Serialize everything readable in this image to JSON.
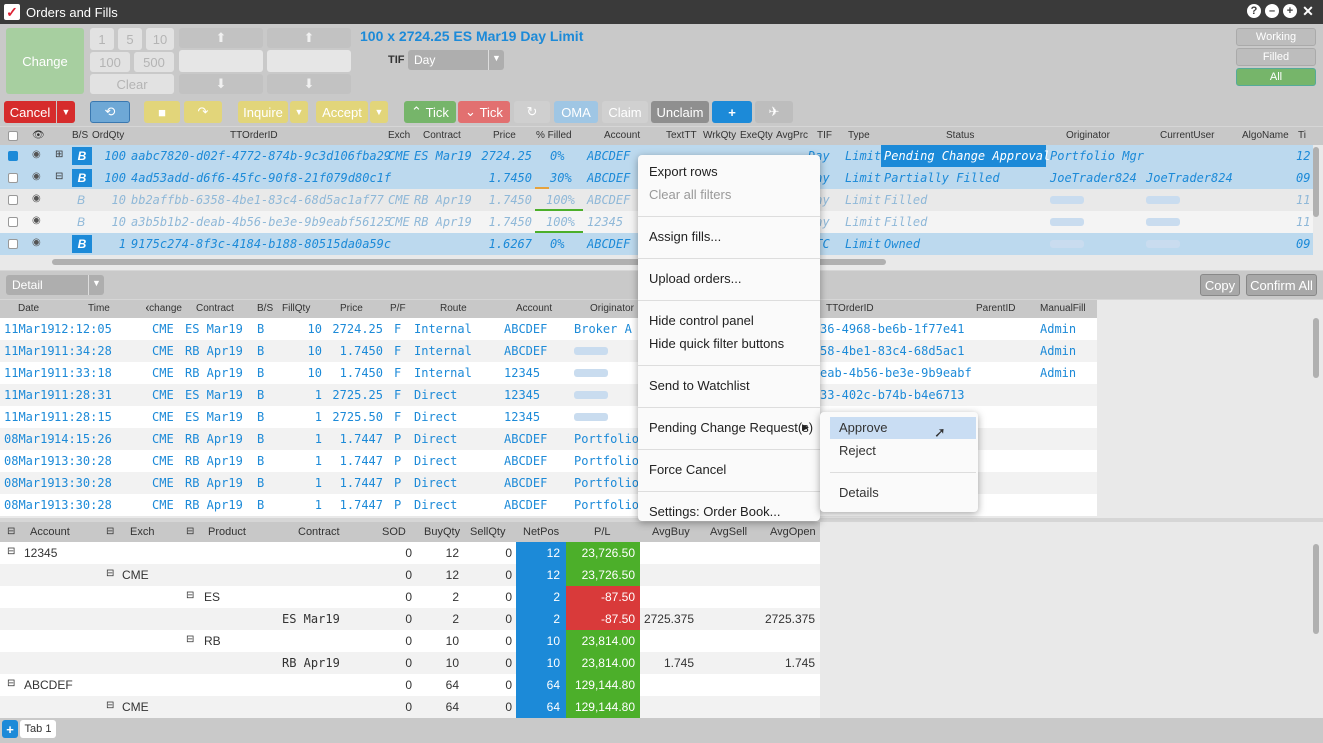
{
  "window": {
    "title": "Orders and Fills"
  },
  "control": {
    "change_label": "Change",
    "qty_buttons": [
      "1",
      "5",
      "10",
      "100",
      "500"
    ],
    "clear_label": "Clear",
    "order_summary": "100 x 2724.25 ES Mar19 Day Limit",
    "tif_label": "TIF",
    "tif_value": "Day",
    "filters": [
      "Working",
      "Filled",
      "All"
    ]
  },
  "toolbar": {
    "cancel": "Cancel",
    "inquire": "Inquire",
    "accept": "Accept",
    "tick_up": "Tick",
    "tick_down": "Tick",
    "oma": "OMA",
    "claim": "Claim",
    "unclaim": "Unclaim"
  },
  "orders": {
    "headers": [
      "B/S",
      "OrdQty",
      "TTOrderID",
      "Exch",
      "Contract",
      "Price",
      "% Filled",
      "Account",
      "TextTT",
      "WrkQty",
      "ExeQty",
      "AvgPrc",
      "TIF",
      "Type",
      "Status",
      "Originator",
      "CurrentUser",
      "AlgoName",
      "Ti"
    ],
    "rows": [
      {
        "bs": "B",
        "qty": "100",
        "id": "aabc7820-d02f-4772-874b-9c3d106fba29",
        "exch": "CME",
        "contract": "ES Mar19",
        "price": "2724.25",
        "filled": "0%",
        "account": "ABCDEF",
        "tif": "Day",
        "type": "Limit",
        "status": "Pending Change Approval",
        "originator": "Portfolio Mgr",
        "user": "",
        "ti": "12"
      },
      {
        "bs": "B",
        "qty": "100",
        "id": "4ad53add-d6f6-45fc-90f8-21f079d80c1f",
        "exch": "",
        "contract": "",
        "price": "1.7450",
        "filled": "30%",
        "account": "ABCDEF",
        "tif": "Day",
        "type": "Limit",
        "status": "Partially Filled",
        "originator": "JoeTrader824",
        "user": "JoeTrader824",
        "ti": "09"
      },
      {
        "bs": "B",
        "qty": "10",
        "id": "bb2affbb-6358-4be1-83c4-68d5ac1af77",
        "exch": "CME",
        "contract": "RB Apr19",
        "price": "1.7450",
        "filled": "100%",
        "account": "ABCDEF",
        "tif": "Day",
        "type": "Limit",
        "status": "Filled",
        "originator": "",
        "user": "",
        "ti": "11"
      },
      {
        "bs": "B",
        "qty": "10",
        "id": "a3b5b1b2-deab-4b56-be3e-9b9eabf56125",
        "exch": "CME",
        "contract": "RB Apr19",
        "price": "1.7450",
        "filled": "100%",
        "account": "12345",
        "tif": "Day",
        "type": "Limit",
        "status": "Filled",
        "originator": "",
        "user": "",
        "ti": "11"
      },
      {
        "bs": "B",
        "qty": "1",
        "id": "9175c274-8f3c-4184-b188-80515da0a59c",
        "exch": "",
        "contract": "",
        "price": "1.6267",
        "filled": "0%",
        "account": "ABCDEF",
        "tif": "GTC",
        "type": "Limit",
        "status": "Owned",
        "originator": "",
        "user": "",
        "ti": "09"
      }
    ]
  },
  "detail": {
    "view": "Detail",
    "copy": "Copy",
    "confirm_all": "Confirm All",
    "headers": [
      "Date",
      "Time",
      "Exchange",
      "Contract",
      "B/S",
      "FillQty",
      "Price",
      "P/F",
      "Route",
      "Account",
      "Originator",
      "TTOrderID",
      "ParentID",
      "ManualFill"
    ],
    "rows": [
      {
        "date": "11Mar19",
        "time": "12:12:05",
        "exch": "CME",
        "contract": "ES Mar19",
        "bs": "B",
        "qty": "10",
        "price": "2724.25",
        "pf": "F",
        "route": "Internal",
        "account": "ABCDEF",
        "orig": "Broker A",
        "ttid": "36-4968-be6b-1f77e41",
        "manual": "Admin"
      },
      {
        "date": "11Mar19",
        "time": "11:34:28",
        "exch": "CME",
        "contract": "RB Apr19",
        "bs": "B",
        "qty": "10",
        "price": "1.7450",
        "pf": "F",
        "route": "Internal",
        "account": "ABCDEF",
        "orig": "",
        "ttid": "58-4be1-83c4-68d5ac1",
        "manual": "Admin"
      },
      {
        "date": "11Mar19",
        "time": "11:33:18",
        "exch": "CME",
        "contract": "RB Apr19",
        "bs": "B",
        "qty": "10",
        "price": "1.7450",
        "pf": "F",
        "route": "Internal",
        "account": "12345",
        "orig": "",
        "ttid": "eab-4b56-be3e-9b9eabf",
        "manual": "Admin"
      },
      {
        "date": "11Mar19",
        "time": "11:28:31",
        "exch": "CME",
        "contract": "ES Mar19",
        "bs": "B",
        "qty": "1",
        "price": "2725.25",
        "pf": "F",
        "route": "Direct",
        "account": "12345",
        "orig": "",
        "ttid": "33-402c-b74b-b4e6713",
        "manual": ""
      },
      {
        "date": "11Mar19",
        "time": "11:28:15",
        "exch": "CME",
        "contract": "ES Mar19",
        "bs": "B",
        "qty": "1",
        "price": "2725.50",
        "pf": "F",
        "route": "Direct",
        "account": "12345",
        "orig": "",
        "ttid": "",
        "manual": ""
      },
      {
        "date": "08Mar19",
        "time": "14:15:26",
        "exch": "CME",
        "contract": "RB Apr19",
        "bs": "B",
        "qty": "1",
        "price": "1.7447",
        "pf": "P",
        "route": "Direct",
        "account": "ABCDEF",
        "orig": "Portfolio",
        "ttid": "",
        "manual": ""
      },
      {
        "date": "08Mar19",
        "time": "13:30:28",
        "exch": "CME",
        "contract": "RB Apr19",
        "bs": "B",
        "qty": "1",
        "price": "1.7447",
        "pf": "P",
        "route": "Direct",
        "account": "ABCDEF",
        "orig": "Portfolio",
        "ttid": "",
        "manual": ""
      },
      {
        "date": "08Mar19",
        "time": "13:30:28",
        "exch": "CME",
        "contract": "RB Apr19",
        "bs": "B",
        "qty": "1",
        "price": "1.7447",
        "pf": "P",
        "route": "Direct",
        "account": "ABCDEF",
        "orig": "Portfolio",
        "ttid": "",
        "manual": ""
      },
      {
        "date": "08Mar19",
        "time": "13:30:28",
        "exch": "CME",
        "contract": "RB Apr19",
        "bs": "B",
        "qty": "1",
        "price": "1.7447",
        "pf": "P",
        "route": "Direct",
        "account": "ABCDEF",
        "orig": "Portfolio",
        "ttid": "",
        "manual": ""
      }
    ]
  },
  "positions": {
    "headers": [
      "Account",
      "Exch",
      "Product",
      "Contract",
      "SOD",
      "BuyQty",
      "SellQty",
      "NetPos",
      "P/L",
      "AvgBuy",
      "AvgSell",
      "AvgOpen"
    ],
    "rows": [
      {
        "account": "12345",
        "exch": "",
        "product": "",
        "contract": "",
        "sod": "0",
        "buy": "12",
        "sell": "0",
        "net": "12",
        "pl": "23,726.50",
        "pl_neg": false,
        "avgbuy": "",
        "avgopen": ""
      },
      {
        "account": "",
        "exch": "CME",
        "product": "",
        "contract": "",
        "sod": "0",
        "buy": "12",
        "sell": "0",
        "net": "12",
        "pl": "23,726.50",
        "pl_neg": false,
        "avgbuy": "",
        "avgopen": ""
      },
      {
        "account": "",
        "exch": "",
        "product": "ES",
        "contract": "",
        "sod": "0",
        "buy": "2",
        "sell": "0",
        "net": "2",
        "pl": "-87.50",
        "pl_neg": true,
        "avgbuy": "",
        "avgopen": ""
      },
      {
        "account": "",
        "exch": "",
        "product": "",
        "contract": "ES Mar19",
        "sod": "0",
        "buy": "2",
        "sell": "0",
        "net": "2",
        "pl": "-87.50",
        "pl_neg": true,
        "avgbuy": "2725.375",
        "avgopen": "2725.375"
      },
      {
        "account": "",
        "exch": "",
        "product": "RB",
        "contract": "",
        "sod": "0",
        "buy": "10",
        "sell": "0",
        "net": "10",
        "pl": "23,814.00",
        "pl_neg": false,
        "avgbuy": "",
        "avgopen": ""
      },
      {
        "account": "",
        "exch": "",
        "product": "",
        "contract": "RB Apr19",
        "sod": "0",
        "buy": "10",
        "sell": "0",
        "net": "10",
        "pl": "23,814.00",
        "pl_neg": false,
        "avgbuy": "1.745",
        "avgopen": "1.745"
      },
      {
        "account": "ABCDEF",
        "exch": "",
        "product": "",
        "contract": "",
        "sod": "0",
        "buy": "64",
        "sell": "0",
        "net": "64",
        "pl": "129,144.80",
        "pl_neg": false,
        "avgbuy": "",
        "avgopen": ""
      },
      {
        "account": "",
        "exch": "CME",
        "product": "",
        "contract": "",
        "sod": "0",
        "buy": "64",
        "sell": "0",
        "net": "64",
        "pl": "129,144.80",
        "pl_neg": false,
        "avgbuy": "",
        "avgopen": ""
      }
    ]
  },
  "context_menu": {
    "items": [
      {
        "label": "Export rows",
        "disabled": false
      },
      {
        "label": "Clear all filters",
        "disabled": true
      },
      {
        "label": "Assign fills...",
        "disabled": false
      },
      {
        "label": "Upload orders...",
        "disabled": false
      },
      {
        "label": "Hide control panel",
        "disabled": false
      },
      {
        "label": "Hide quick filter buttons",
        "disabled": false
      },
      {
        "label": "Send to Watchlist",
        "disabled": false
      },
      {
        "label": "Pending Change Request(s)",
        "disabled": false
      },
      {
        "label": "Force Cancel",
        "disabled": false
      },
      {
        "label": "Settings: Order Book...",
        "disabled": false
      }
    ]
  },
  "submenu": {
    "approve": "Approve",
    "reject": "Reject",
    "details": "Details"
  },
  "tabs": {
    "tab1": "Tab 1"
  },
  "colors": {
    "blue": "#1c8ad8",
    "green": "#4caf2a",
    "red": "#d93a3a",
    "cancel_red": "#d62c2c",
    "selected_row": "#bcd9ee"
  }
}
